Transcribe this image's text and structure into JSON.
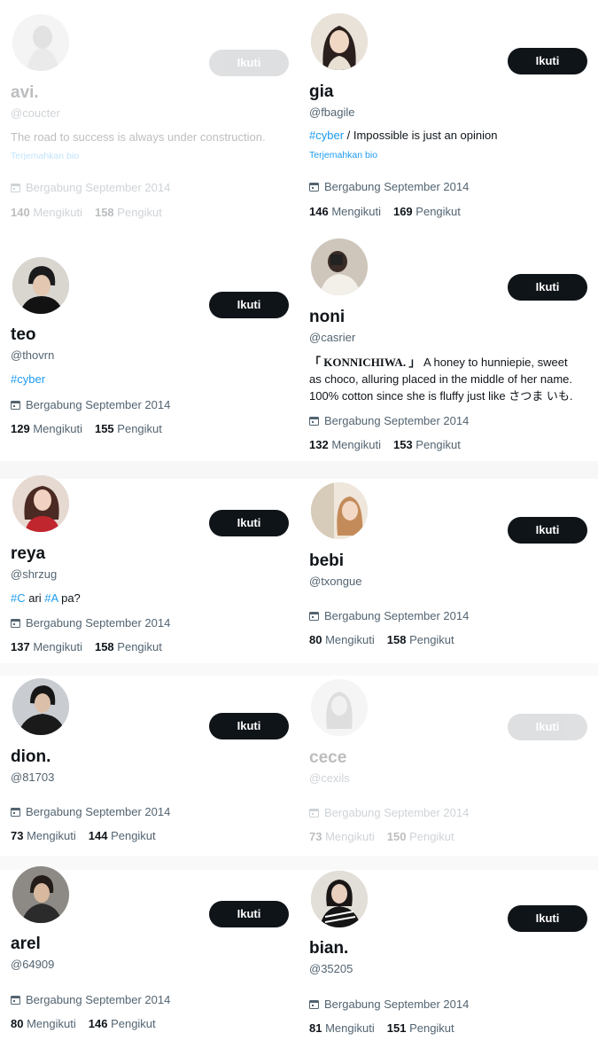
{
  "follow_label": "Ikuti",
  "joined_label": "Bergabung September 2014",
  "following_label": "Mengikuti",
  "followers_label": "Pengikut",
  "translate_label": "Terjemahkan bio",
  "accent_color": "#1d9bf0",
  "button_color": "#0f1419",
  "profiles": [
    {
      "name": "avi.",
      "handle": "@coucter",
      "bio": "The road to success is always under construction.",
      "following": "140",
      "followers": "158"
    },
    {
      "name": "gia",
      "handle": "@fbagile",
      "bio_tag": "#cyber",
      "bio_rest": " / Impossible is just an opinion",
      "following": "146",
      "followers": "169"
    },
    {
      "name": "teo",
      "handle": "@thovrn",
      "bio_tag": "#cyber",
      "following": "129",
      "followers": "155"
    },
    {
      "name": "noni",
      "handle": "@casrier",
      "bio_line1_bold": "「 KONNICHIWA. 」",
      "bio_line1": " A honey to hunniepie, sweet",
      "bio_line2": "as choco, alluring placed in the middle of her name.",
      "bio_line3": "100% cotton since she is fluffy just like さつま いも.",
      "following": "132",
      "followers": "153"
    },
    {
      "name": "reya",
      "handle": "@shrzug",
      "bio_tag1": "#C",
      "bio_mid": " ari ",
      "bio_tag2": "#A",
      "bio_end": " pa?",
      "following": "137",
      "followers": "158"
    },
    {
      "name": "bebi",
      "handle": "@txongue",
      "following": "80",
      "followers": "158"
    },
    {
      "name": "dion.",
      "handle": "@81703",
      "following": "73",
      "followers": "144"
    },
    {
      "name": "cece",
      "handle": "@cexils",
      "following": "73",
      "followers": "150"
    },
    {
      "name": "arel",
      "handle": "@64909",
      "following": "80",
      "followers": "146"
    },
    {
      "name": "bian.",
      "handle": "@35205",
      "following": "81",
      "followers": "151"
    }
  ]
}
